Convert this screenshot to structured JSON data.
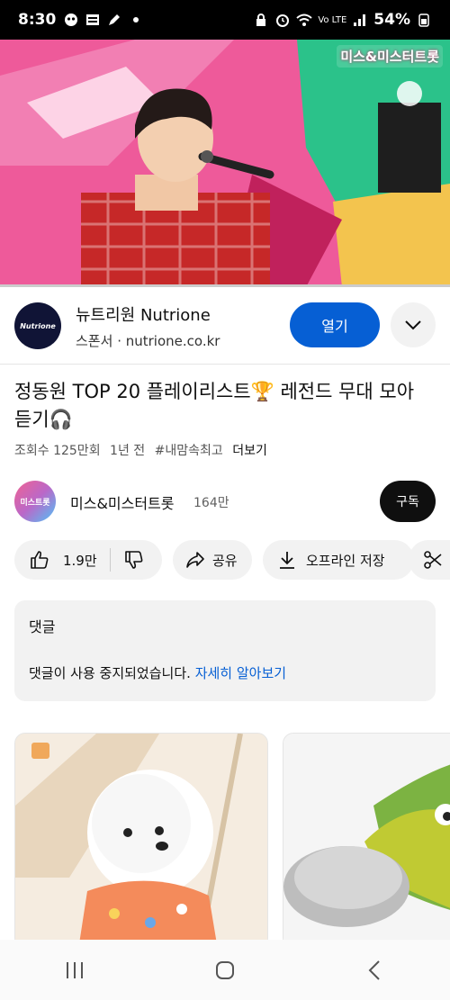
{
  "status_bar": {
    "time": "8:30",
    "network": "Vo LTE",
    "battery": "54%"
  },
  "video": {
    "watermark": "미스&미스터트롯",
    "progress": 0.0
  },
  "sponsor": {
    "logo_text": "Nutrione",
    "name": "뉴트리원 Nutrione",
    "label": "스폰서",
    "separator": "·",
    "url": "nutrione.co.kr",
    "open_label": "열기"
  },
  "video_info": {
    "title": "정동원 TOP 20 플레이리스트🏆 레전드 무대 모아듣기🎧",
    "views": "조회수 125만회",
    "age": "1년 전",
    "hashtag": "#내맘속최고",
    "more": "더보기"
  },
  "channel": {
    "avatar_text": "미스트롯",
    "name": "미스&미스터트롯",
    "subscribers": "164만",
    "subscribe_label": "구독"
  },
  "actions": {
    "like_count": "1.9만",
    "share_label": "공유",
    "save_label": "오프라인 저장"
  },
  "comments": {
    "title": "댓글",
    "disabled_text": "댓글이 사용 중지되었습니다.",
    "learn_more": "자세히 알아보기"
  },
  "colors": {
    "accent_blue": "#065fd4",
    "progress_red": "#ff0000",
    "chip_bg": "#f2f2f2"
  }
}
